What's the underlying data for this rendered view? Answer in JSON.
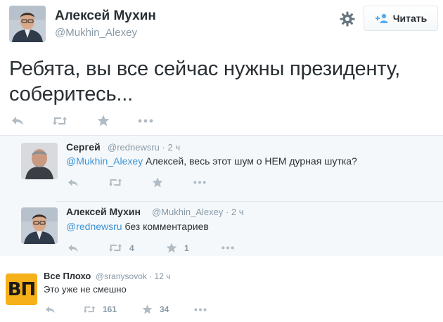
{
  "main": {
    "author_name": "Алексей Мухин",
    "author_handle": "@Mukhin_Alexey",
    "follow_label": "Читать",
    "text": "Ребята, вы все сейчас нужны президенту, соберитесь..."
  },
  "replies": [
    {
      "name": "Сергей",
      "handle": "@rednewsru",
      "time": "· 2 ч",
      "mention": "@Mukhin_Alexey",
      "text": " Алексей, весь этот шум о НЕМ дурная шутка?",
      "retweets": "",
      "favorites": ""
    },
    {
      "name": "Алексей Мухин",
      "handle": "@Mukhin_Alexey",
      "time": "· 2 ч",
      "mention": "@rednewsru",
      "text": " без комментариев",
      "retweets": "4",
      "favorites": "1"
    }
  ],
  "bottom": {
    "name": "Все Плохо",
    "handle": "@sranysovok",
    "time": "· 12 ч",
    "text": "Это уже не смешно",
    "logo": "ВП",
    "retweets": "161",
    "favorites": "34"
  },
  "colors": {
    "text": "#292f33",
    "muted": "#8899a6",
    "link": "#3b94d9",
    "panel_bg": "#f5f8fa",
    "logo_bg": "#f6b019"
  },
  "icons": [
    "gear-icon",
    "follow-person-icon",
    "reply-icon",
    "retweet-icon",
    "favorite-icon",
    "more-icon"
  ]
}
